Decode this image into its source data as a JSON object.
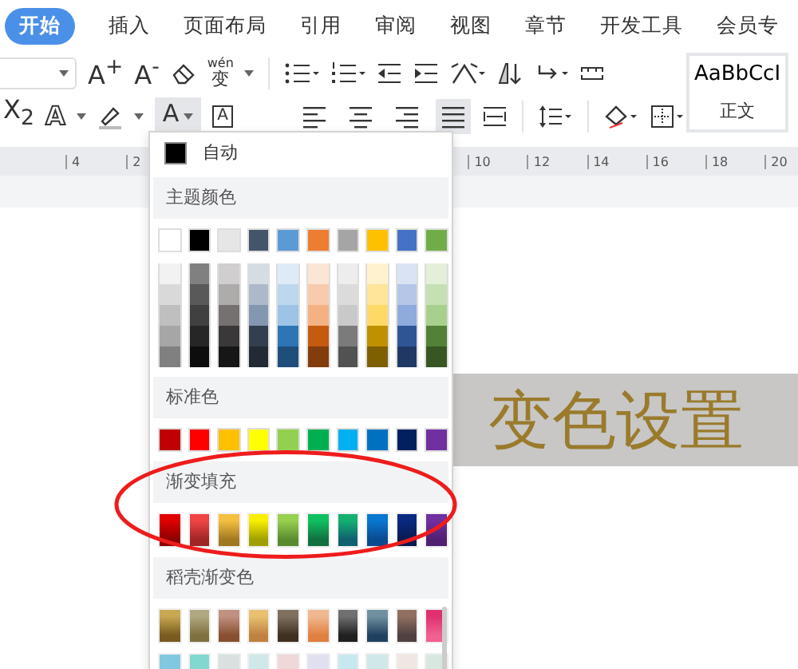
{
  "tabs": [
    {
      "label": "开始",
      "selected": true
    },
    {
      "label": "插入",
      "selected": false
    },
    {
      "label": "页面布局",
      "selected": false
    },
    {
      "label": "引用",
      "selected": false
    },
    {
      "label": "审阅",
      "selected": false
    },
    {
      "label": "视图",
      "selected": false
    },
    {
      "label": "章节",
      "selected": false
    },
    {
      "label": "开发工具",
      "selected": false
    },
    {
      "label": "会员专",
      "selected": false
    }
  ],
  "toolbar": {
    "grow_font": "A$^{+}$",
    "shrink_font": "A$^{-}$",
    "phonetic_top": "wén",
    "phonetic_char": "变",
    "subscript": "X$_{2}$",
    "text_effect": "A",
    "font_color": {
      "glyph": "A",
      "selected": true
    },
    "char_border": "A",
    "alignment": [
      {
        "kind": "left",
        "selected": false
      },
      {
        "kind": "center",
        "selected": false
      },
      {
        "kind": "right",
        "selected": false
      },
      {
        "kind": "justify",
        "selected": true
      }
    ],
    "style_preview": "AaBbCcI",
    "style_name": "正文"
  },
  "ruler": {
    "left_labels": [
      "4",
      "2"
    ],
    "right_labels": [
      "10",
      "12",
      "14",
      "16",
      "18",
      "20"
    ]
  },
  "document_text": "变色设置",
  "color_menu": {
    "auto": {
      "label": "自动",
      "color": "#000000"
    },
    "theme_title": "主题颜色",
    "theme_colors": [
      {
        "color": "#ffffff"
      },
      {
        "color": "#000000"
      },
      {
        "color": "#e7e6e6"
      },
      {
        "color": "#44546a"
      },
      {
        "color": "#5b9bd5"
      },
      {
        "color": "#ed7d31"
      },
      {
        "color": "#a5a5a5"
      },
      {
        "color": "#ffc000"
      },
      {
        "color": "#4472c4"
      },
      {
        "color": "#70ad47"
      }
    ],
    "shade_rows": [
      {
        "swatches": [
          {
            "color": "#f2f2f2"
          },
          {
            "color": "#808080"
          },
          {
            "color": "#d0cece"
          },
          {
            "color": "#d6dce4"
          },
          {
            "color": "#deebf6"
          },
          {
            "color": "#fbe5d5"
          },
          {
            "color": "#ededed"
          },
          {
            "color": "#fff2cc"
          },
          {
            "color": "#dae3f3"
          },
          {
            "color": "#e2efd9"
          }
        ]
      },
      {
        "swatches": [
          {
            "color": "#d9d9d9"
          },
          {
            "color": "#595959"
          },
          {
            "color": "#aeabab"
          },
          {
            "color": "#adb9ca"
          },
          {
            "color": "#bdd7ee"
          },
          {
            "color": "#f8cbad"
          },
          {
            "color": "#dbdbdb"
          },
          {
            "color": "#fee599"
          },
          {
            "color": "#b4c7e7"
          },
          {
            "color": "#c5e0b3"
          }
        ]
      },
      {
        "swatches": [
          {
            "color": "#bfbfbf"
          },
          {
            "color": "#404040"
          },
          {
            "color": "#767171"
          },
          {
            "color": "#8497b0"
          },
          {
            "color": "#9dc3e6"
          },
          {
            "color": "#f4b183"
          },
          {
            "color": "#c9c9c9"
          },
          {
            "color": "#ffd965"
          },
          {
            "color": "#8faadc"
          },
          {
            "color": "#a8d08d"
          }
        ]
      },
      {
        "swatches": [
          {
            "color": "#a6a6a6"
          },
          {
            "color": "#262626"
          },
          {
            "color": "#3a3838"
          },
          {
            "color": "#323f4f"
          },
          {
            "color": "#2e75b5"
          },
          {
            "color": "#c55a11"
          },
          {
            "color": "#7b7b7b"
          },
          {
            "color": "#bf9000"
          },
          {
            "color": "#2f5597"
          },
          {
            "color": "#538135"
          }
        ]
      },
      {
        "swatches": [
          {
            "color": "#808080"
          },
          {
            "color": "#0d0d0d"
          },
          {
            "color": "#171616"
          },
          {
            "color": "#222a35"
          },
          {
            "color": "#1e4e79"
          },
          {
            "color": "#833c0b"
          },
          {
            "color": "#525252"
          },
          {
            "color": "#7f6000"
          },
          {
            "color": "#1f3864"
          },
          {
            "color": "#375623"
          }
        ]
      }
    ],
    "standard_title": "标准色",
    "standard_colors": [
      {
        "color": "#c00000"
      },
      {
        "color": "#ff0000"
      },
      {
        "color": "#ffc000"
      },
      {
        "color": "#ffff00"
      },
      {
        "color": "#92d050"
      },
      {
        "color": "#00b050"
      },
      {
        "color": "#00b0f0"
      },
      {
        "color": "#0070c0"
      },
      {
        "color": "#002060"
      },
      {
        "color": "#7030a0"
      }
    ],
    "gradient_title": "渐变填充",
    "gradient_fills": [
      {
        "top": {
          "color": "#e00000"
        },
        "bottom": {
          "color": "#8b0000"
        }
      },
      {
        "top": {
          "color": "#f04545"
        },
        "bottom": {
          "color": "#a02525"
        }
      },
      {
        "top": {
          "color": "#f5c040"
        },
        "bottom": {
          "color": "#a07820"
        }
      },
      {
        "top": {
          "color": "#f8f000"
        },
        "bottom": {
          "color": "#a0a000"
        }
      },
      {
        "top": {
          "color": "#98d050"
        },
        "bottom": {
          "color": "#5a8a30"
        }
      },
      {
        "top": {
          "color": "#10c060"
        },
        "bottom": {
          "color": "#107040"
        }
      },
      {
        "top": {
          "color": "#15b070"
        },
        "bottom": {
          "color": "#106070"
        }
      },
      {
        "top": {
          "color": "#0878d0"
        },
        "bottom": {
          "color": "#0a4a90"
        }
      },
      {
        "top": {
          "color": "#0a2a80"
        },
        "bottom": {
          "color": "#081a50"
        }
      },
      {
        "top": {
          "color": "#7030a0"
        },
        "bottom": {
          "color": "#502070"
        }
      }
    ],
    "docer_title": "稻壳渐变色",
    "docer_rows": [
      {
        "swatches": [
          {
            "top": {
              "color": "#c8a850"
            },
            "bottom": {
              "color": "#7a5a20"
            }
          },
          {
            "top": {
              "color": "#b0a880"
            },
            "bottom": {
              "color": "#807040"
            }
          },
          {
            "top": {
              "color": "#c09080"
            },
            "bottom": {
              "color": "#885030"
            }
          },
          {
            "top": {
              "color": "#e8c070"
            },
            "bottom": {
              "color": "#c08040"
            }
          },
          {
            "top": {
              "color": "#807060"
            },
            "bottom": {
              "color": "#403020"
            }
          },
          {
            "top": {
              "color": "#f0b890"
            },
            "bottom": {
              "color": "#e08040"
            }
          },
          {
            "top": {
              "color": "#707070"
            },
            "bottom": {
              "color": "#202020"
            }
          },
          {
            "top": {
              "color": "#7090a0"
            },
            "bottom": {
              "color": "#204060"
            }
          },
          {
            "top": {
              "color": "#907060"
            },
            "bottom": {
              "color": "#504040"
            }
          },
          {
            "top": {
              "color": "#e03070"
            },
            "bottom": {
              "color": "#f06090"
            }
          }
        ]
      },
      {
        "swatches": [
          {
            "top": {
              "color": "#80c8e0"
            }
          },
          {
            "top": {
              "color": "#80d8d0"
            }
          },
          {
            "top": {
              "color": "#d8e0e0"
            }
          },
          {
            "top": {
              "color": "#d0e8e8"
            }
          },
          {
            "top": {
              "color": "#f0d8d8"
            }
          },
          {
            "top": {
              "color": "#e0e0f0"
            }
          },
          {
            "top": {
              "color": "#c8e8f0"
            }
          },
          {
            "top": {
              "color": "#d0e8e8"
            }
          },
          {
            "top": {
              "color": "#f0e8e0"
            }
          },
          {
            "top": {
              "color": "#d8e8e0"
            }
          }
        ]
      }
    ]
  }
}
